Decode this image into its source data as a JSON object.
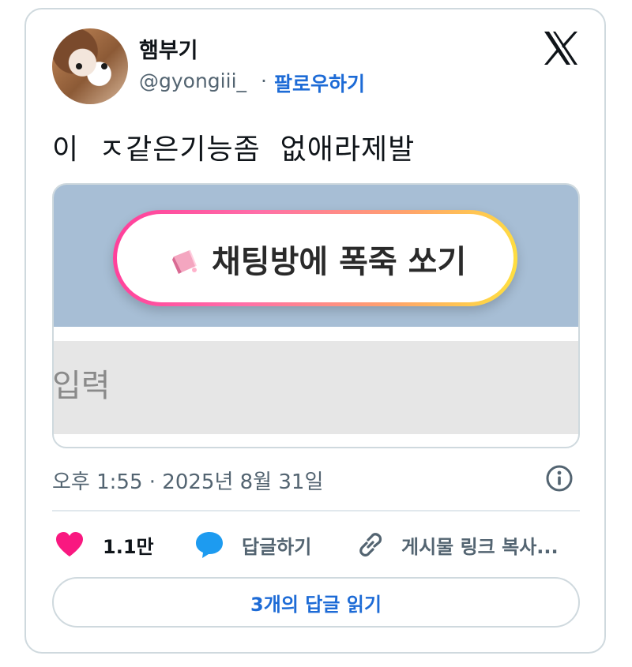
{
  "author": {
    "display_name": "햄부기",
    "handle": "@gyongiii_",
    "separator": "·",
    "follow_label": "팔로우하기"
  },
  "tweet": {
    "text": "이  ㅈ같은기능좀  없애라제발"
  },
  "media": {
    "button_label": "채팅방에 폭죽 쏘기",
    "input_hint": "입력"
  },
  "meta": {
    "timestamp": "오후 1:55 · 2025년 8월 31일"
  },
  "actions": {
    "like_count": "1.1만",
    "reply_label": "답글하기",
    "copy_link_label": "게시물 링크 복사..."
  },
  "read_replies_label": "3개의 답글 읽기",
  "colors": {
    "accent": "#1d6bd6",
    "like": "#f91880",
    "reply_icon": "#1d9bf0",
    "muted": "#536471",
    "border": "#cfd9de",
    "media_top": "#a7bed5"
  },
  "icons": [
    "x-logo-icon",
    "firecracker-icon",
    "info-icon",
    "heart-icon",
    "speech-bubble-icon",
    "link-icon"
  ]
}
